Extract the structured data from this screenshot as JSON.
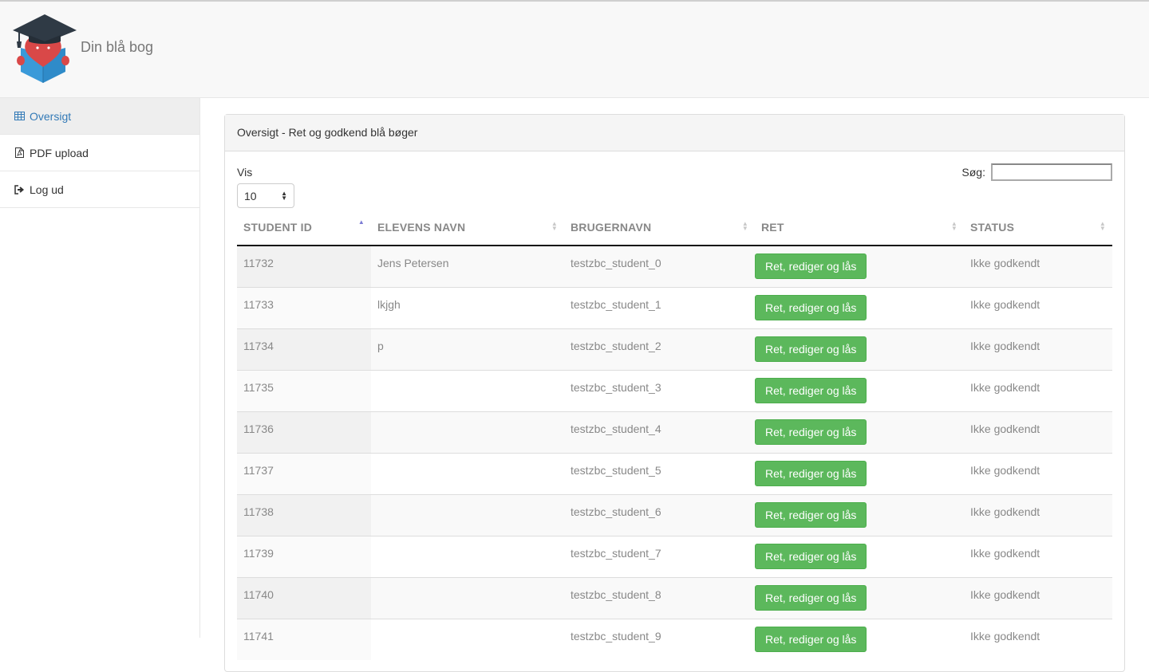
{
  "header": {
    "brand": "Din blå bog"
  },
  "sidebar": {
    "items": [
      {
        "label": "Oversigt",
        "icon": "table-icon",
        "active": true
      },
      {
        "label": "PDF upload",
        "icon": "pdf-file-icon",
        "active": false
      },
      {
        "label": "Log ud",
        "icon": "logout-icon",
        "active": false
      }
    ]
  },
  "panel": {
    "title": "Oversigt - Ret og godkend blå bøger",
    "length_label": "Vis",
    "length_value": "10",
    "search_label": "Søg:",
    "search_value": ""
  },
  "table": {
    "columns": [
      "STUDENT ID",
      "ELEVENS NAVN",
      "BRUGERNAVN",
      "RET",
      "STATUS"
    ],
    "sort": {
      "column": "STUDENT ID",
      "direction": "asc"
    },
    "rows": [
      {
        "id": "11732",
        "name": "Jens Petersen",
        "username": "testzbc_student_0",
        "action": "Ret, rediger og lås",
        "status": "Ikke godkendt"
      },
      {
        "id": "11733",
        "name": "lkjgh",
        "username": "testzbc_student_1",
        "action": "Ret, rediger og lås",
        "status": "Ikke godkendt"
      },
      {
        "id": "11734",
        "name": "p",
        "username": "testzbc_student_2",
        "action": "Ret, rediger og lås",
        "status": "Ikke godkendt"
      },
      {
        "id": "11735",
        "name": "",
        "username": "testzbc_student_3",
        "action": "Ret, rediger og lås",
        "status": "Ikke godkendt"
      },
      {
        "id": "11736",
        "name": "",
        "username": "testzbc_student_4",
        "action": "Ret, rediger og lås",
        "status": "Ikke godkendt"
      },
      {
        "id": "11737",
        "name": "",
        "username": "testzbc_student_5",
        "action": "Ret, rediger og lås",
        "status": "Ikke godkendt"
      },
      {
        "id": "11738",
        "name": "",
        "username": "testzbc_student_6",
        "action": "Ret, rediger og lås",
        "status": "Ikke godkendt"
      },
      {
        "id": "11739",
        "name": "",
        "username": "testzbc_student_7",
        "action": "Ret, rediger og lås",
        "status": "Ikke godkendt"
      },
      {
        "id": "11740",
        "name": "",
        "username": "testzbc_student_8",
        "action": "Ret, rediger og lås",
        "status": "Ikke godkendt"
      },
      {
        "id": "11741",
        "name": "",
        "username": "testzbc_student_9",
        "action": "Ret, rediger og lås",
        "status": "Ikke godkendt"
      }
    ]
  },
  "colors": {
    "accent": "#337ab7",
    "button": "#5cb85c",
    "logo_hat": "#2f3a45",
    "logo_heart": "#d94848",
    "logo_book": "#3a9ad9"
  }
}
